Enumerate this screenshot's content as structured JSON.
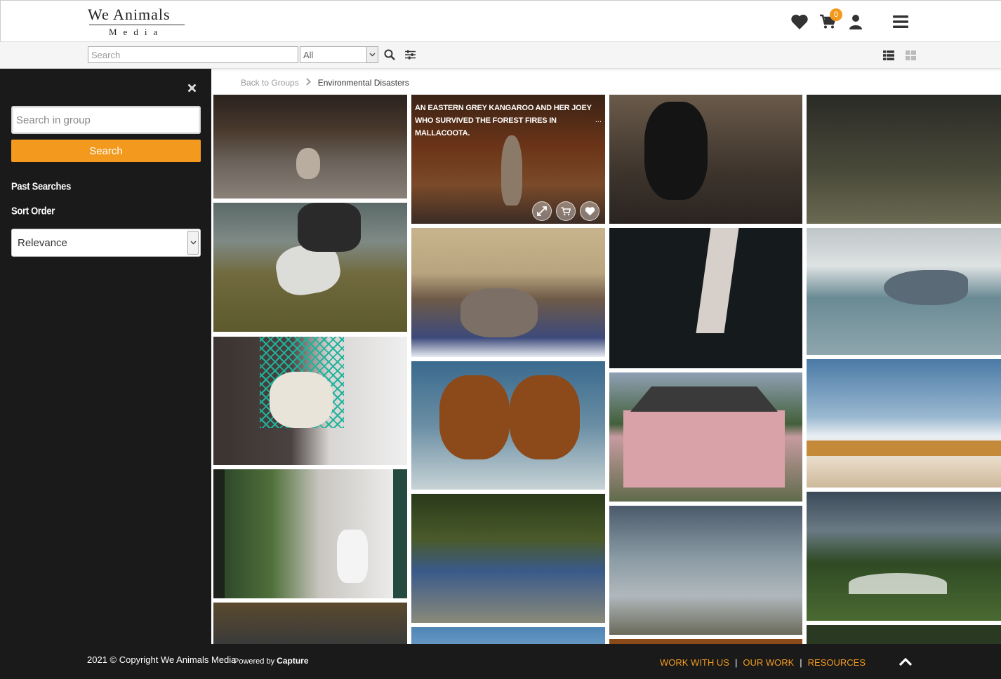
{
  "header": {
    "logo_line1": "We Animals",
    "logo_line2": "Media",
    "cart_count": "0",
    "icons": [
      "heart-icon",
      "cart-icon",
      "user-icon",
      "hamburger-menu-icon"
    ]
  },
  "toolbar": {
    "search_placeholder": "Search",
    "filter_value": "All",
    "icons": [
      "search-icon",
      "sliders-icon",
      "list-view-icon",
      "grid-view-icon"
    ]
  },
  "sidebar": {
    "search_placeholder": "Search in group",
    "search_button": "Search",
    "past_searches_label": "Past Searches",
    "sort_order_label": "Sort Order",
    "sort_value": "Relevance"
  },
  "breadcrumb": {
    "back_label": "Back to Groups",
    "current": "Environmental Disasters"
  },
  "gallery": {
    "hover_caption": "An Eastern grey kangaroo and her joey who survived the forest fires in Mallacoota.",
    "more_indicator": "..."
  },
  "footer": {
    "copyright": "2021 © Copyright We Animals Media",
    "powered_by": "Powered by",
    "powered_brand": "Capture",
    "links": [
      "WORK WITH US",
      "OUR WORK",
      "RESOURCES"
    ]
  },
  "colors": {
    "accent": "#f39a1e",
    "sidebar_bg": "#1a1a1a",
    "footer_bg": "#1a1a1a"
  }
}
